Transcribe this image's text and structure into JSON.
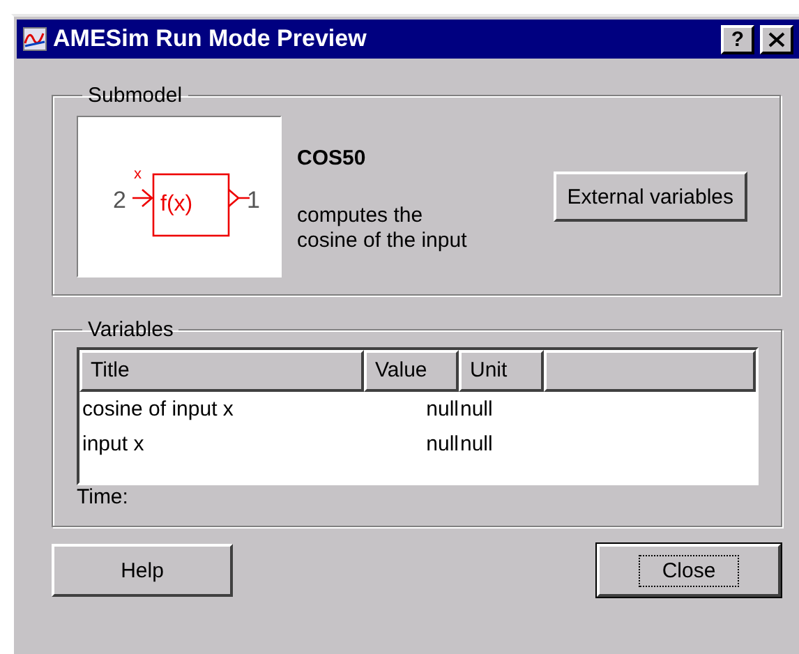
{
  "window": {
    "title": "AMESim Run Mode Preview",
    "help_button": "?"
  },
  "submodel": {
    "legend": "Submodel",
    "diagram": {
      "input_port": "2",
      "input_variable": "x",
      "function": "f(x)",
      "output_port": "1"
    },
    "name": "COS50",
    "description": "computes the cosine of the input",
    "button": "External variables"
  },
  "variables": {
    "legend": "Variables",
    "columns": [
      "Title",
      "Value",
      "Unit"
    ],
    "rows": [
      {
        "title": "cosine of input x",
        "value": "null",
        "unit": "null"
      },
      {
        "title": "input x",
        "value": "null",
        "unit": "null"
      }
    ],
    "time_label": "Time:"
  },
  "buttons": [
    {
      "label": "Help",
      "default": false
    },
    {
      "label": "Close",
      "default": true
    }
  ]
}
